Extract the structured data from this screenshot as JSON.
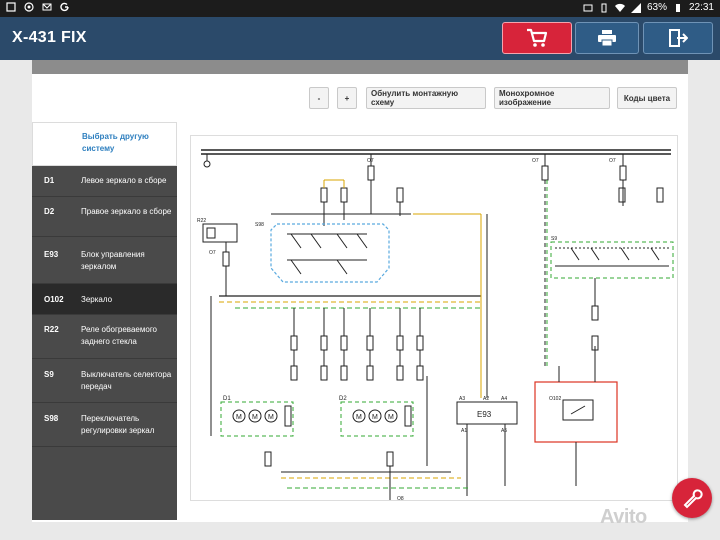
{
  "status": {
    "battery": "63%",
    "time": "22:31"
  },
  "app": {
    "title": "X-431 FIX"
  },
  "toolbar": {
    "minus": "-",
    "plus": "+",
    "reset": "Обнулить монтажную схему",
    "mono": "Монохромное изображение",
    "colors": "Коды цвета"
  },
  "sidebar": {
    "header": "Выбрать другую систему",
    "items": [
      {
        "code": "D1",
        "label": "Левое зеркало в сборе"
      },
      {
        "code": "D2",
        "label": "Правое зеркало в сборе"
      },
      {
        "code": "E93",
        "label": "Блок управления зеркалом"
      },
      {
        "code": "O102",
        "label": "Зеркало"
      },
      {
        "code": "R22",
        "label": "Реле обогреваемого заднего стекла"
      },
      {
        "code": "S9",
        "label": "Выключатель селектора передач"
      },
      {
        "code": "S98",
        "label": "Переключатель регулировки зеркал"
      }
    ]
  },
  "diagram": {
    "labels": {
      "o7a": "O7",
      "o7b": "O7",
      "o7c": "O7",
      "o7d": "O7",
      "r22": "R22",
      "s98": "S98",
      "s9": "S9",
      "d1": "D1",
      "d2": "D2",
      "e93": "E93",
      "o102": "O102",
      "o8": "O8",
      "a3": "A3",
      "a2": "A2",
      "a4": "A4",
      "a1": "A1",
      "a5": "A5"
    }
  },
  "watermark": "Avito"
}
